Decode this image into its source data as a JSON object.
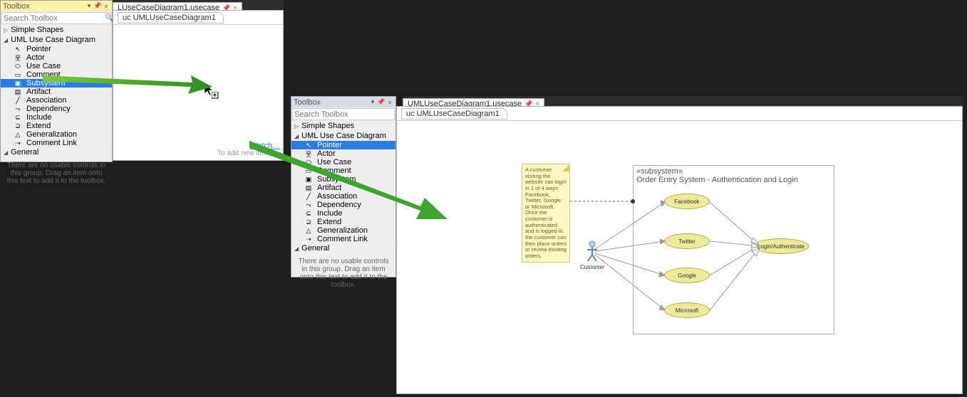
{
  "panel1": {
    "title": "Toolbox",
    "searchPlaceholder": "Search Toolbox",
    "section1": "Simple Shapes",
    "section2": "UML Use Case Diagram",
    "items": [
      "Pointer",
      "Actor",
      "Use Case",
      "Comment",
      "Subsystem",
      "Artifact",
      "Association",
      "Dependency",
      "Include",
      "Extend",
      "Generalization",
      "Comment Link"
    ],
    "selectedIndex": 4,
    "section3": "General",
    "hint": "There are no usable controls in this group. Drag an item onto this text to add it to the toolbox."
  },
  "panel2": {
    "title": "Toolbox",
    "searchPlaceholder": "Search Toolbox",
    "section1": "Simple Shapes",
    "section2": "UML Use Case Diagram",
    "items": [
      "Pointer",
      "Actor",
      "Use Case",
      "Comment",
      "Subsystem",
      "Artifact",
      "Association",
      "Dependency",
      "Include",
      "Extend",
      "Generalization",
      "Comment Link"
    ],
    "selectedIndex": 0,
    "section3": "General",
    "hint": "There are no usable controls in this group. Drag an item onto this text to add it to the toolbox."
  },
  "tab1": {
    "label": "LUseCaseDiagram1.usecase"
  },
  "tab2": {
    "label": "UMLUseCaseDiagram1.usecase"
  },
  "breadcrumb": "uc UMLUseCaseDiagram1",
  "canvasHint1": "Watch…",
  "canvasHint2": "To add new items…",
  "diagram": {
    "noteText": "A customer visiting the website can login in 1 of 4 ways: Facebook, Twitter, Google or Microsoft. Once the customer is authenticated and is logged in, the customer can then place orders or review existing orders.",
    "actor": "Customer",
    "subsysStereotype": "«subsystem»",
    "subsysName": "Order Entry System - Authentication and Login",
    "usecases": [
      "Facebook",
      "Twitter",
      "Google",
      "Microsoft",
      "Login/Authenticate"
    ]
  }
}
